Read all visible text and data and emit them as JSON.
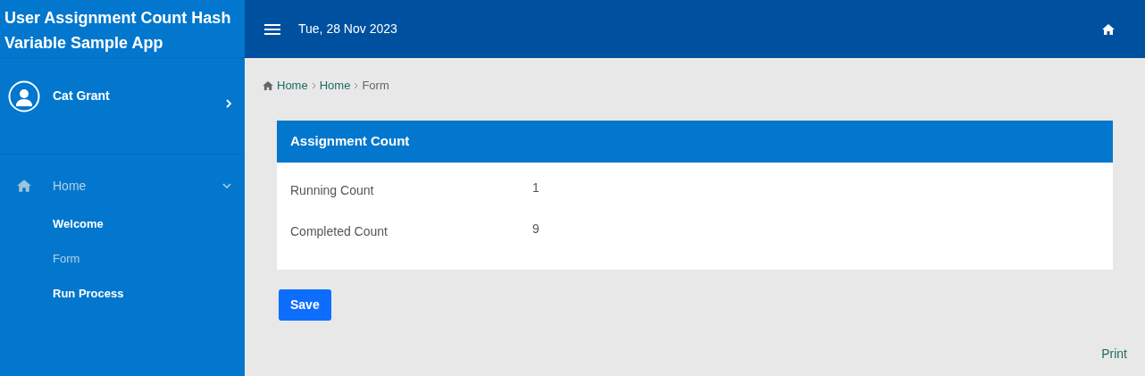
{
  "app_title": "User Assignment Count Hash Variable Sample App",
  "user": {
    "name": "Cat Grant"
  },
  "nav": [
    {
      "label": "Home",
      "selected": true,
      "expanded": true,
      "children": [
        {
          "label": "Welcome",
          "selected": false
        },
        {
          "label": "Form",
          "selected": true
        },
        {
          "label": "Run Process",
          "selected": false
        }
      ]
    }
  ],
  "header": {
    "date": "Tue, 28 Nov 2023"
  },
  "breadcrumb": [
    {
      "label": "Home",
      "current": false
    },
    {
      "label": "Home",
      "current": false
    },
    {
      "label": "Form",
      "current": true
    }
  ],
  "panel": {
    "title": "Assignment Count",
    "fields": [
      {
        "label": "Running Count",
        "value": "1"
      },
      {
        "label": "Completed Count",
        "value": "9"
      }
    ]
  },
  "buttons": [
    "Save"
  ],
  "footer_link": "Print"
}
